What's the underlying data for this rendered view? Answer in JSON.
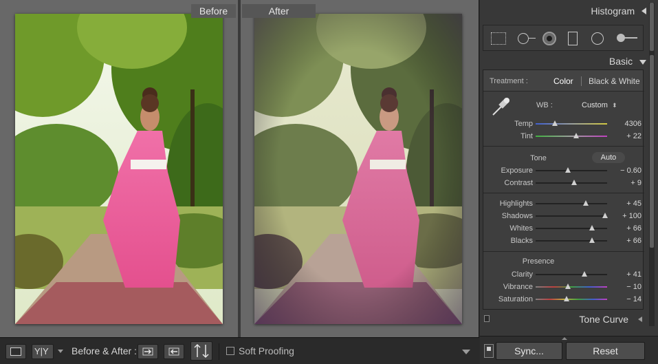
{
  "viewer": {
    "before_label": "Before",
    "after_label": "After"
  },
  "toolbar": {
    "view_mode_icon": "loupe-icon",
    "yy_label": "Y|Y",
    "before_after_label": "Before & After :",
    "soft_proofing_label": "Soft Proofing"
  },
  "panel": {
    "histogram_title": "Histogram",
    "basic_title": "Basic",
    "treatment_label": "Treatment :",
    "treatment_color": "Color",
    "treatment_bw": "Black & White",
    "wb_label": "WB :",
    "wb_value": "Custom",
    "temp": {
      "label": "Temp",
      "value": "4306",
      "pos": 0.27
    },
    "tint": {
      "label": "Tint",
      "value": "+ 22",
      "pos": 0.57
    },
    "tone_title": "Tone",
    "auto_label": "Auto",
    "exposure": {
      "label": "Exposure",
      "value": "− 0.60",
      "pos": 0.45
    },
    "contrast": {
      "label": "Contrast",
      "value": "+ 9",
      "pos": 0.54
    },
    "highlights": {
      "label": "Highlights",
      "value": "+ 45",
      "pos": 0.7
    },
    "shadows": {
      "label": "Shadows",
      "value": "+ 100",
      "pos": 0.97
    },
    "whites": {
      "label": "Whites",
      "value": "+ 66",
      "pos": 0.79
    },
    "blacks": {
      "label": "Blacks",
      "value": "+ 66",
      "pos": 0.79
    },
    "presence_title": "Presence",
    "clarity": {
      "label": "Clarity",
      "value": "+ 41",
      "pos": 0.68
    },
    "vibrance": {
      "label": "Vibrance",
      "value": "− 10",
      "pos": 0.45
    },
    "saturation": {
      "label": "Saturation",
      "value": "− 14",
      "pos": 0.43
    },
    "tone_curve_title": "Tone Curve",
    "sync_label": "Sync...",
    "reset_label": "Reset"
  },
  "colors": {
    "panel_bg": "#383838",
    "viewer_bg": "#686868"
  }
}
